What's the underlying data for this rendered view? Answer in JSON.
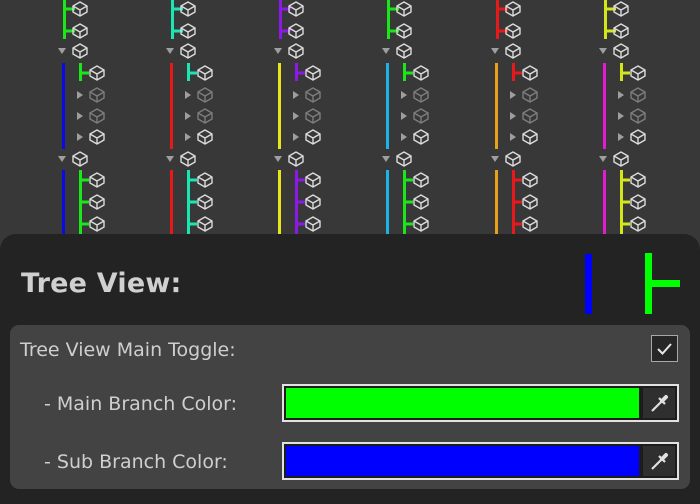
{
  "colors": {
    "background": "#383838",
    "panel": "#232323",
    "row_box": "#434343",
    "collapsed_cube": "#7d7d7d",
    "cube": "#dcdcdc",
    "arrow": "#9e9e9e"
  },
  "tree_preview": {
    "columns": [
      {
        "main_branch": "#0a0ae6",
        "sub_branch": "#1ae61a"
      },
      {
        "main_branch": "#e61a1a",
        "sub_branch": "#1ae6b4"
      },
      {
        "main_branch": "#e6e61a",
        "sub_branch": "#8c1ae6"
      },
      {
        "main_branch": "#1ab4e6",
        "sub_branch": "#1ae61a"
      },
      {
        "main_branch": "#e6a01a",
        "sub_branch": "#e61a1a"
      },
      {
        "main_branch": "#e61ad2",
        "sub_branch": "#d2e61a"
      }
    ],
    "icons": {
      "cube": "cube-icon",
      "foldout": "triangle-icon"
    }
  },
  "panel": {
    "title": "Tree View:",
    "legend": {
      "main_branch_color": "#0000ff",
      "sub_branch_color": "#00ff00"
    }
  },
  "settings": {
    "toggle": {
      "label": "Tree View Main Toggle:",
      "checked": true,
      "check_mark": "✓"
    },
    "main_branch": {
      "label": "- Main Branch Color:",
      "color": "#00ff00",
      "icon": "eyedropper-icon"
    },
    "sub_branch": {
      "label": "- Sub Branch Color:",
      "color": "#0000ff",
      "icon": "eyedropper-icon"
    }
  }
}
